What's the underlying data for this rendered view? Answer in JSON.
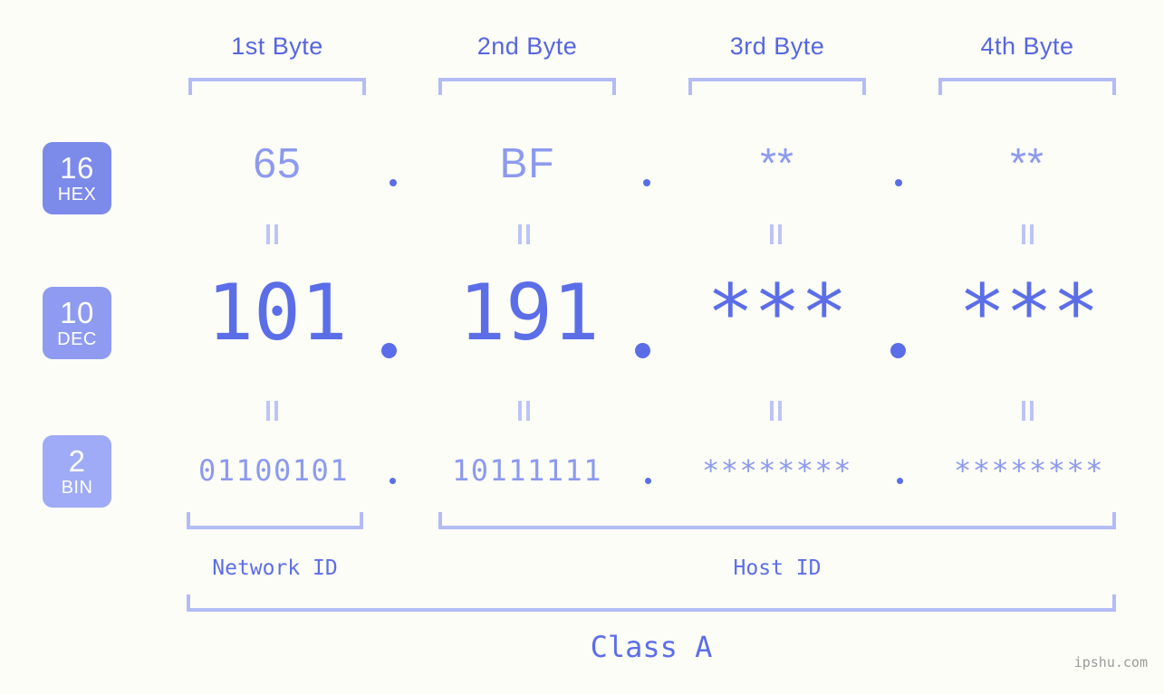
{
  "meta": {
    "watermark": "ipshu.com",
    "background_color": "#fdfdf8",
    "accent_strong": "#5b6ee8",
    "accent_light": "#8c9aee",
    "accent_pale": "#b3bcf5"
  },
  "byte_headers": [
    {
      "label": "1st Byte"
    },
    {
      "label": "2nd Byte"
    },
    {
      "label": "3rd Byte"
    },
    {
      "label": "4th Byte"
    }
  ],
  "radix_badges": [
    {
      "number": "16",
      "system": "HEX",
      "color": "#7c8ae9"
    },
    {
      "number": "10",
      "system": "DEC",
      "color": "#8e9bf0"
    },
    {
      "number": "2",
      "system": "BIN",
      "color": "#9fabf6"
    }
  ],
  "rows": {
    "hex": {
      "radix": "16",
      "system": "HEX",
      "values": [
        "65",
        "BF",
        "**",
        "**"
      ],
      "separators": [
        ".",
        ".",
        "."
      ]
    },
    "dec": {
      "radix": "10",
      "system": "DEC",
      "values": [
        "101",
        "191",
        "***",
        "***"
      ],
      "separators": [
        ".",
        ".",
        "."
      ]
    },
    "bin": {
      "radix": "2",
      "system": "BIN",
      "values": [
        "01100101",
        "10111111",
        "********",
        "********"
      ],
      "separators": [
        ".",
        ".",
        "."
      ]
    }
  },
  "equality_marks": {
    "symbol": "||",
    "count_per_row": 4
  },
  "segments": [
    {
      "name": "Network ID",
      "label": "Network ID"
    },
    {
      "name": "Host ID",
      "label": "Host ID"
    }
  ],
  "class": {
    "label": "Class A"
  }
}
